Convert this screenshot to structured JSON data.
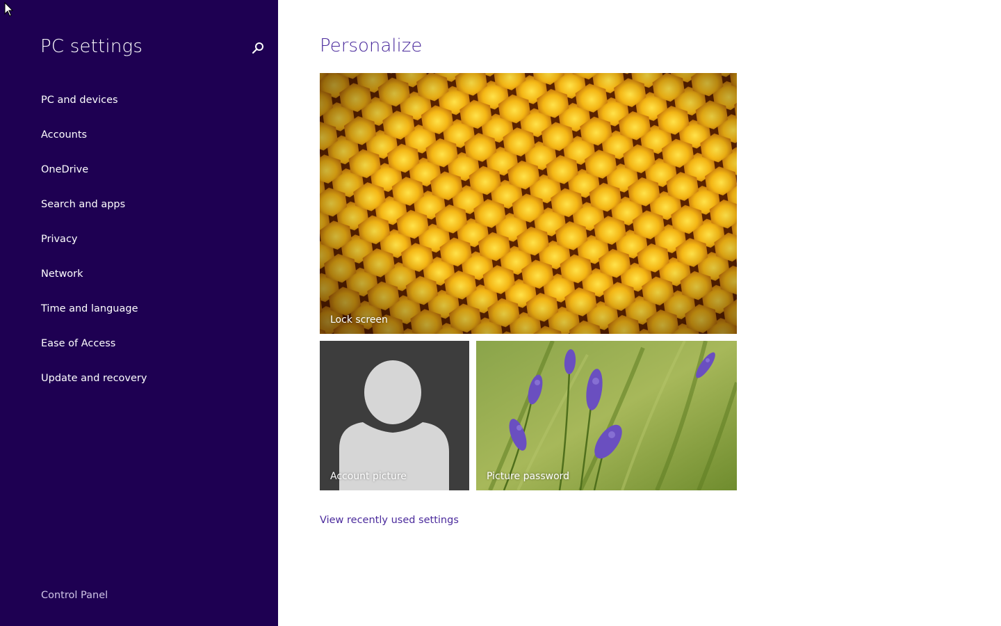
{
  "sidebar": {
    "title": "PC settings",
    "search_icon": "search-icon",
    "items": [
      {
        "label": "PC and devices"
      },
      {
        "label": "Accounts"
      },
      {
        "label": "OneDrive"
      },
      {
        "label": "Search and apps"
      },
      {
        "label": "Privacy"
      },
      {
        "label": "Network"
      },
      {
        "label": "Time and language"
      },
      {
        "label": "Ease of Access"
      },
      {
        "label": "Update and recovery"
      }
    ],
    "control_panel": "Control Panel"
  },
  "main": {
    "title": "Personalize",
    "tiles": {
      "lock_screen": "Lock screen",
      "account_picture": "Account picture",
      "picture_password": "Picture password"
    },
    "recent_link": "View recently used settings"
  },
  "colors": {
    "sidebar_bg": "#1e0052",
    "accent": "#4a2a9c"
  }
}
